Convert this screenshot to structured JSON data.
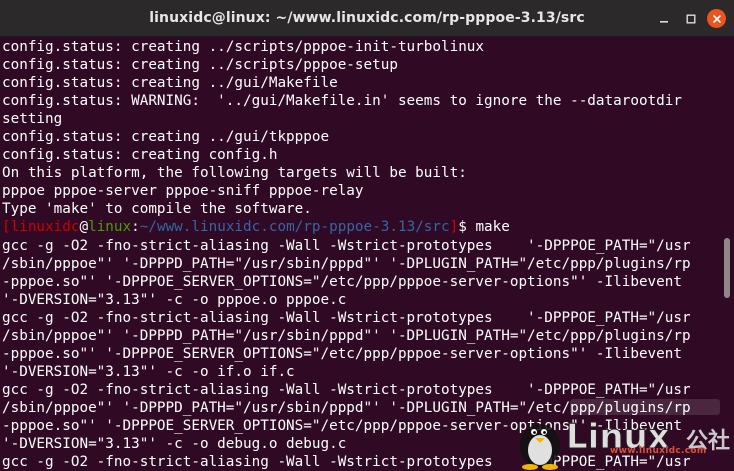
{
  "window": {
    "title": "linuxidc@linux: ~/www.linuxidc.com/rp-pppoe-3.13/src",
    "buttons": {
      "minimize": "minimize-icon",
      "maximize": "maximize-icon",
      "close": "close-icon"
    }
  },
  "terminal": {
    "lines_before_prompt": [
      "config.status: creating ../scripts/pppoe-init-turbolinux",
      "config.status: creating ../scripts/pppoe-setup",
      "config.status: creating ../gui/Makefile",
      "config.status: WARNING:  '../gui/Makefile.in' seems to ignore the --datarootdir",
      "setting",
      "config.status: creating ../gui/tkpppoe",
      "config.status: creating config.h",
      "On this platform, the following targets will be built:",
      "pppoe pppoe-server pppoe-sniff pppoe-relay",
      "Type 'make' to compile the software."
    ],
    "prompt": {
      "open_bracket": "[",
      "user": "linuxidc",
      "at": "@",
      "host": "linux",
      "colon": ":",
      "path": "~/www.linuxidc.com/rp-pppoe-3.13/src",
      "close_bracket": "]",
      "dollar": "$ ",
      "command": "make"
    },
    "lines_after_prompt": [
      "gcc -g -O2 -fno-strict-aliasing -Wall -Wstrict-prototypes    '-DPPPOE_PATH=\"/usr",
      "/sbin/pppoe\"' '-DPPPD_PATH=\"/usr/sbin/pppd\"' '-DPLUGIN_PATH=\"/etc/ppp/plugins/rp",
      "-pppoe.so\"' '-DPPPOE_SERVER_OPTIONS=\"/etc/ppp/pppoe-server-options\"' -Ilibevent",
      "'-DVERSION=\"3.13\"' -c -o pppoe.o pppoe.c",
      "gcc -g -O2 -fno-strict-aliasing -Wall -Wstrict-prototypes    '-DPPPOE_PATH=\"/usr",
      "/sbin/pppoe\"' '-DPPPD_PATH=\"/usr/sbin/pppd\"' '-DPLUGIN_PATH=\"/etc/ppp/plugins/rp",
      "-pppoe.so\"' '-DPPPOE_SERVER_OPTIONS=\"/etc/ppp/pppoe-server-options\"' -Ilibevent",
      "'-DVERSION=\"3.13\"' -c -o if.o if.c",
      "gcc -g -O2 -fno-strict-aliasing -Wall -Wstrict-prototypes    '-DPPPOE_PATH=\"/usr",
      "/sbin/pppoe\"' '-DPPPD_PATH=\"/usr/sbin/pppd\"' '-DPLUGIN_PATH=\"/etc/ppp/plugins/rp",
      "-pppoe.so\"' '-DPPPOE_SERVER_OPTIONS=\"/etc/ppp/pppoe-server-options\"' -Ilibevent",
      "'-DVERSION=\"3.13\"' -c -o debug.o debug.c",
      "gcc -g -O2 -fno-strict-aliasing -Wall -Wstrict-prototypes    '-DPPPOE_PATH=\"/usr"
    ]
  },
  "watermark": {
    "brand": "Linux",
    "suffix": "公社",
    "url": "www.linuxidc.com"
  },
  "colors": {
    "background": "#300a24",
    "titlebar": "#2b2929",
    "close_button": "#e95420",
    "prompt_user": "#cc0000",
    "prompt_host": "#4e9a06",
    "prompt_path": "#3465a4",
    "text": "#ffffff"
  }
}
